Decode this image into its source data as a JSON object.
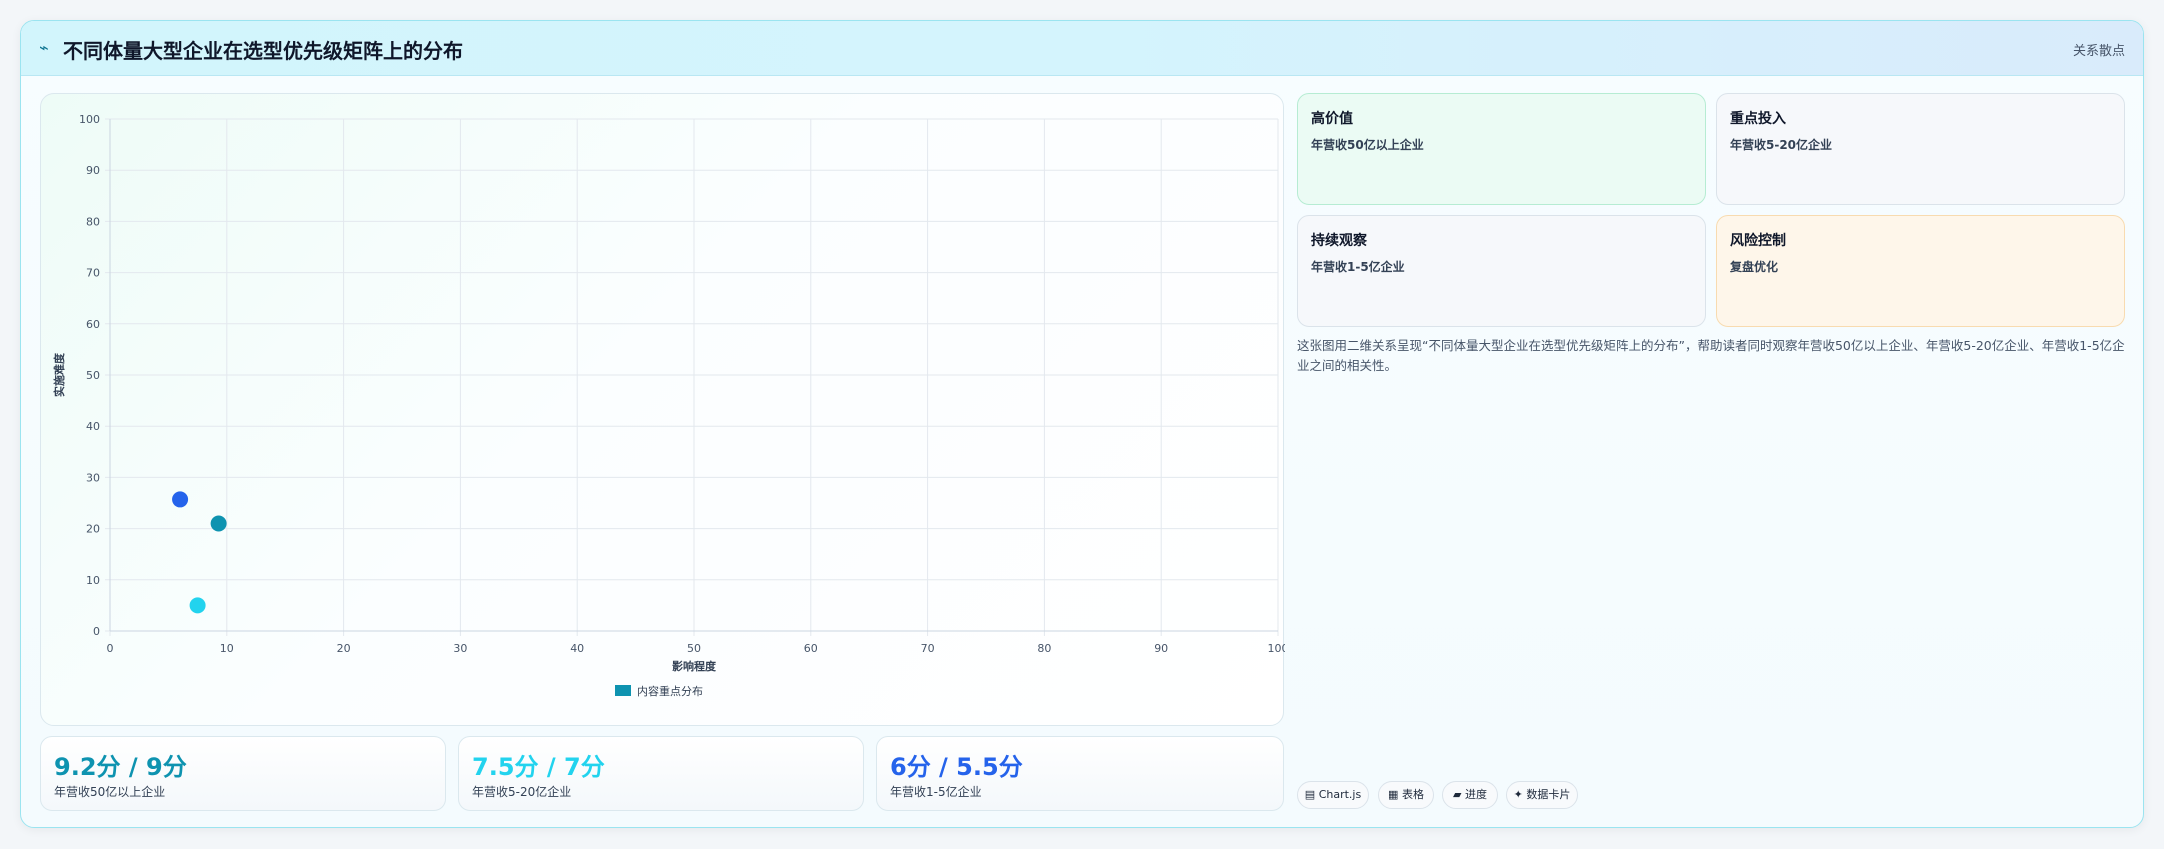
{
  "header": {
    "icon": "pulse-icon",
    "title": "不同体量大型企业在选型优先级矩阵上的分布",
    "tag": "关系散点"
  },
  "chart_data": {
    "type": "scatter",
    "xlabel": "影响程度",
    "ylabel": "实施难度",
    "xlim": [
      0,
      100
    ],
    "ylim": [
      0,
      100
    ],
    "xticks": [
      0,
      10,
      20,
      30,
      40,
      50,
      60,
      70,
      80,
      90,
      100
    ],
    "yticks": [
      0,
      10,
      20,
      30,
      40,
      50,
      60,
      70,
      80,
      90,
      100
    ],
    "grid": true,
    "legend_position": "bottom",
    "series": [
      {
        "name": "内容重点分布",
        "color": "#0e93b0",
        "points": [
          {
            "x": 6,
            "y": 25.7,
            "color": "#2563eb"
          },
          {
            "x": 9.3,
            "y": 21,
            "color": "#0e93b0"
          },
          {
            "x": 7.5,
            "y": 5,
            "color": "#22d3ee"
          }
        ]
      }
    ]
  },
  "stats": [
    {
      "value": "9.2分 / 9分",
      "label": "年营收50亿以上企业",
      "color": "#0e93b0"
    },
    {
      "value": "7.5分 / 7分",
      "label": "年营收5-20亿企业",
      "color": "#22d3ee"
    },
    {
      "value": "6分 / 5.5分",
      "label": "年营收1-5亿企业",
      "color": "#2563eb"
    }
  ],
  "quadrants": [
    {
      "title": "高价值",
      "subtitle": "年营收50亿以上企业",
      "bg": "#ebfbf4",
      "border": "#b6ecd3"
    },
    {
      "title": "重点投入",
      "subtitle": "年营收5-20亿企业",
      "bg": "#f6f8fb",
      "border": "#dbe3ea"
    },
    {
      "title": "持续观察",
      "subtitle": "年营收1-5亿企业",
      "bg": "#f6f8fb",
      "border": "#dbe3ea"
    },
    {
      "title": "风险控制",
      "subtitle": "复盘优化",
      "bg": "#fef6ea",
      "border": "#f8dbb0"
    }
  ],
  "description": "这张图用二维关系呈现“不同体量大型企业在选型优先级矩阵上的分布”，帮助读者同时观察年营收50亿以上企业、年营收5-20亿企业、年营收1-5亿企业之间的相关性。",
  "chips": [
    {
      "icon": "chart-icon",
      "glyph": "▤",
      "label": "Chart.js"
    },
    {
      "icon": "table-icon",
      "glyph": "▦",
      "label": "表格"
    },
    {
      "icon": "progress-icon",
      "glyph": "▰",
      "label": "进度"
    },
    {
      "icon": "sparkle-icon",
      "glyph": "✦",
      "label": "数据卡片"
    }
  ]
}
